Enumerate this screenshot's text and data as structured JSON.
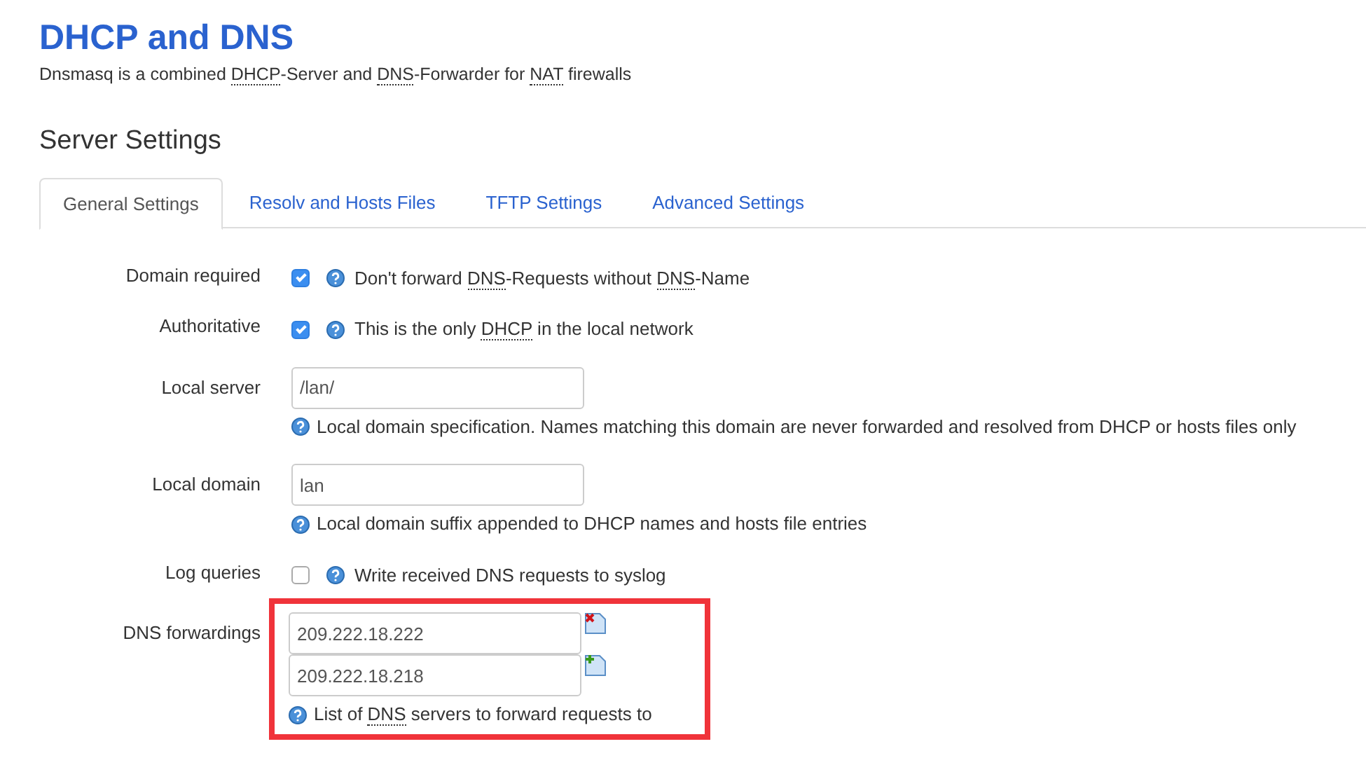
{
  "title": "DHCP and DNS",
  "description": [
    {
      "text": "Dnsmasq is a combined ",
      "abbr": false
    },
    {
      "text": "DHCP",
      "abbr": true
    },
    {
      "text": "-Server and ",
      "abbr": false
    },
    {
      "text": "DNS",
      "abbr": true
    },
    {
      "text": "-Forwarder for ",
      "abbr": false
    },
    {
      "text": "NAT",
      "abbr": true
    },
    {
      "text": " firewalls",
      "abbr": false
    }
  ],
  "section_title": "Server Settings",
  "tabs": [
    {
      "label": "General Settings",
      "selected": true
    },
    {
      "label": "Resolv and Hosts Files",
      "selected": false
    },
    {
      "label": "TFTP Settings",
      "selected": false
    },
    {
      "label": "Advanced Settings",
      "selected": false
    }
  ],
  "fields": [
    {
      "kind": "checkbox",
      "label": "Domain required",
      "checked": true,
      "help": [
        {
          "text": "Don't forward ",
          "abbr": false
        },
        {
          "text": "DNS",
          "abbr": true
        },
        {
          "text": "-Requests without ",
          "abbr": false
        },
        {
          "text": "DNS",
          "abbr": true
        },
        {
          "text": "-Name",
          "abbr": false
        }
      ]
    },
    {
      "kind": "checkbox",
      "label": "Authoritative",
      "checked": true,
      "help": [
        {
          "text": "This is the only ",
          "abbr": false
        },
        {
          "text": "DHCP",
          "abbr": true
        },
        {
          "text": " in the local network",
          "abbr": false
        }
      ]
    },
    {
      "kind": "text",
      "label": "Local server",
      "values": [
        "/lan/"
      ],
      "help": [
        {
          "text": "Local domain specification. Names matching this domain are never forwarded and resolved from DHCP or hosts files only",
          "abbr": false
        }
      ]
    },
    {
      "kind": "text",
      "label": "Local domain",
      "values": [
        "lan"
      ],
      "help": [
        {
          "text": "Local domain suffix appended to DHCP names and hosts file entries",
          "abbr": false
        }
      ]
    },
    {
      "kind": "checkbox",
      "label": "Log queries",
      "checked": false,
      "help": [
        {
          "text": "Write received DNS requests to syslog",
          "abbr": false
        }
      ]
    },
    {
      "kind": "list",
      "label": "DNS forwardings",
      "values": [
        "209.222.18.222",
        "209.222.18.218"
      ],
      "highlighted": true,
      "help": [
        {
          "text": "List of ",
          "abbr": false
        },
        {
          "text": "DNS",
          "abbr": true
        },
        {
          "text": " servers to forward requests to",
          "abbr": false
        }
      ]
    }
  ]
}
